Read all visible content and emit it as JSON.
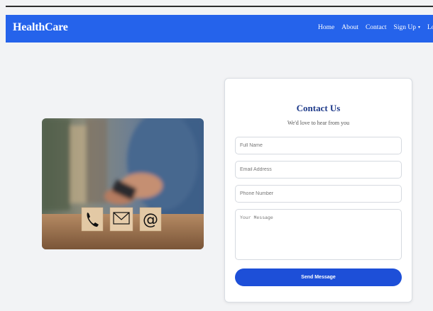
{
  "navbar": {
    "brand": "HealthCare",
    "links": [
      {
        "label": "Home"
      },
      {
        "label": "About"
      },
      {
        "label": "Contact"
      },
      {
        "label": "Sign Up",
        "caret": "▾"
      },
      {
        "label": "Login"
      }
    ]
  },
  "contact": {
    "title": "Contact Us",
    "subtitle": "We'd love to hear from you",
    "fields": {
      "name_placeholder": "Full Name",
      "email_placeholder": "Email Address",
      "phone_placeholder": "Phone Number",
      "message_placeholder": "Your Message"
    },
    "submit_label": "Send Message"
  },
  "image": {
    "icons": [
      "phone-icon",
      "envelope-icon",
      "at-sign-icon"
    ]
  },
  "colors": {
    "navbar": "#2563eb",
    "title": "#1e3a8a",
    "button": "#1d4fd8",
    "background": "#f2f3f5"
  }
}
